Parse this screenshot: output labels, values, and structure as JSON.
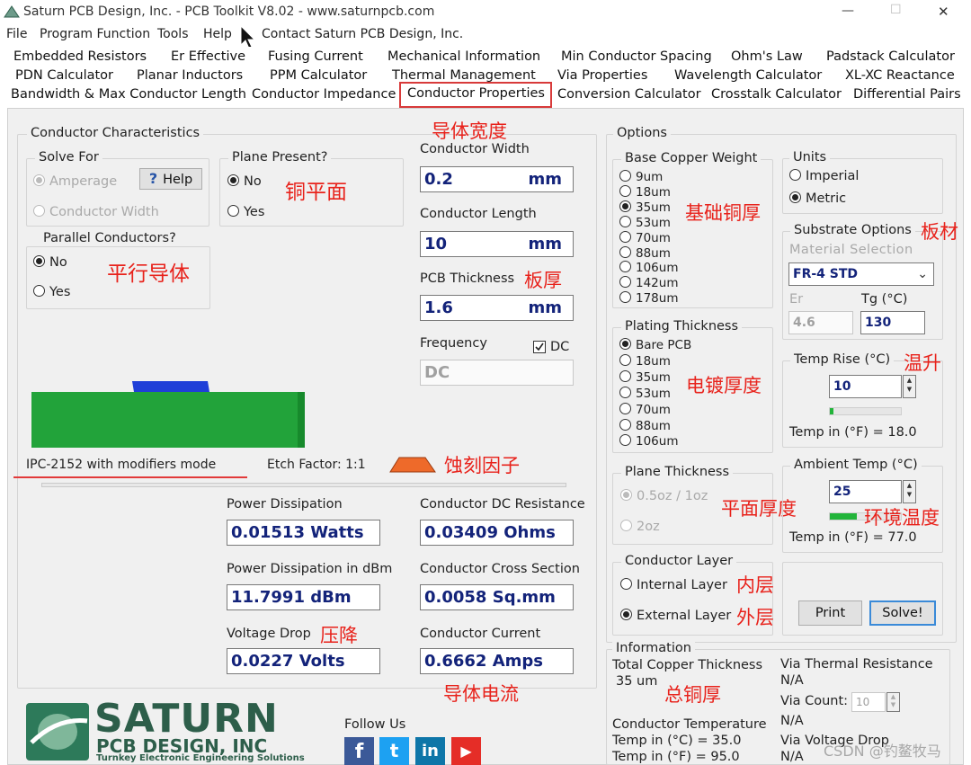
{
  "window": {
    "title": "Saturn PCB Design, Inc. - PCB Toolkit V8.02 - www.saturnpcb.com",
    "min": "—",
    "max": "☐",
    "close": "✕"
  },
  "menu": {
    "items": [
      "File",
      "Program Function",
      "Tools",
      "Help"
    ],
    "contact": "Contact Saturn PCB Design, Inc."
  },
  "tabs": {
    "row1": [
      "Embedded Resistors",
      "Er Effective",
      "Fusing Current",
      "Mechanical Information",
      "Min Conductor Spacing",
      "Ohm's Law",
      "Padstack Calculator"
    ],
    "row2": [
      "PDN Calculator",
      "Planar Inductors",
      "PPM Calculator",
      "Thermal Management",
      "Via Properties",
      "Wavelength Calculator",
      "XL-XC Reactance"
    ],
    "row3": [
      "Bandwidth & Max Conductor Length",
      "Conductor Impedance",
      "Conductor Properties",
      "Conversion Calculator",
      "Crosstalk Calculator",
      "Differential Pairs"
    ]
  },
  "characteristics": {
    "title": "Conductor Characteristics",
    "solve_for": {
      "title": "Solve For",
      "amperage": "Amperage",
      "width": "Conductor Width",
      "help": "Help",
      "help_icon": "?"
    },
    "plane": {
      "title": "Plane Present?",
      "no": "No",
      "yes": "Yes"
    },
    "parallel": {
      "title": "Parallel Conductors?",
      "no": "No",
      "yes": "Yes"
    },
    "width": {
      "label": "Conductor Width",
      "value": "0.2",
      "unit": "mm"
    },
    "length": {
      "label": "Conductor Length",
      "value": "10",
      "unit": "mm"
    },
    "thickness": {
      "label": "PCB Thickness",
      "value": "1.6",
      "unit": "mm"
    },
    "frequency": {
      "label": "Frequency",
      "dc_label": "DC",
      "value": "DC"
    },
    "mode": "IPC-2152 with modifiers mode",
    "etch": "Etch Factor: 1:1"
  },
  "results": {
    "power": {
      "label": "Power Dissipation",
      "value": "0.01513 Watts"
    },
    "resistance": {
      "label": "Conductor DC Resistance",
      "value": "0.03409 Ohms"
    },
    "dbm": {
      "label": "Power Dissipation in dBm",
      "value": "11.7991 dBm"
    },
    "cross": {
      "label": "Conductor Cross Section",
      "value": "0.0058 Sq.mm"
    },
    "vdrop": {
      "label": "Voltage Drop",
      "value": "0.0227 Volts"
    },
    "current": {
      "label": "Conductor Current",
      "value": "0.6662 Amps"
    }
  },
  "logo": {
    "big": "SATURN",
    "sub": "PCB DESIGN, INC",
    "tag": "Turnkey Electronic Engineering Solutions"
  },
  "follow": {
    "label": "Follow Us",
    "facebook": "f",
    "twitter": "t",
    "linkedin": "in",
    "youtube": "▶"
  },
  "options": {
    "title": "Options",
    "copper": {
      "title": "Base Copper Weight",
      "items": [
        "9um",
        "18um",
        "35um",
        "53um",
        "70um",
        "88um",
        "106um",
        "142um",
        "178um"
      ]
    },
    "plating": {
      "title": "Plating Thickness",
      "items": [
        "Bare PCB",
        "18um",
        "35um",
        "53um",
        "70um",
        "88um",
        "106um"
      ]
    },
    "plane_thickness": {
      "title": "Plane Thickness",
      "a": "0.5oz / 1oz",
      "b": "2oz"
    },
    "layer": {
      "title": "Conductor Layer",
      "internal": "Internal Layer",
      "external": "External Layer"
    },
    "units": {
      "title": "Units",
      "imperial": "Imperial",
      "metric": "Metric"
    },
    "substrate": {
      "title": "Substrate Options",
      "material_label": "Material Selection",
      "material": "FR-4 STD",
      "er_label": "Er",
      "er": "4.6",
      "tg_label": "Tg (°C)",
      "tg": "130"
    },
    "rise": {
      "title": "Temp Rise (°C)",
      "value": "10",
      "fahr": "Temp in (°F) = 18.0"
    },
    "ambient": {
      "title": "Ambient Temp (°C)",
      "value": "25",
      "fahr": "Temp in (°F) = 77.0"
    },
    "print": "Print",
    "solve": "Solve!"
  },
  "info": {
    "title": "Information",
    "total_label": "Total Copper Thickness",
    "total_value": "35 um",
    "temp_label": "Conductor Temperature",
    "temp_c": "Temp in (°C) = 35.0",
    "temp_f": "Temp in (°F) = 95.0",
    "via_res_label": "Via Thermal Resistance",
    "via_res": "N/A",
    "via_count_label": "Via Count:",
    "via_count": "10",
    "via_count_na": "N/A",
    "via_drop_label": "Via Voltage Drop",
    "via_drop": "N/A"
  },
  "notes": {
    "width": "导体宽度",
    "plane": "铜平面",
    "parallel": "平行导体",
    "thickness": "板厚",
    "etch": "蚀刻因子",
    "vdrop": "压降",
    "current": "导体电流",
    "copper": "基础铜厚",
    "plating": "电镀厚度",
    "plane_thick": "平面厚度",
    "internal": "内层",
    "external": "外层",
    "total": "总铜厚",
    "substrate": "板材",
    "rise": "温升",
    "ambient": "环境温度"
  },
  "watermark": "CSDN @钓鳌牧马",
  "colors": {
    "accent_red": "#e8221b",
    "value_blue": "#13237a",
    "pcb_green": "#22a33a",
    "copper_blue": "#1f3fd8",
    "etch_orange": "#ee6a2a"
  }
}
